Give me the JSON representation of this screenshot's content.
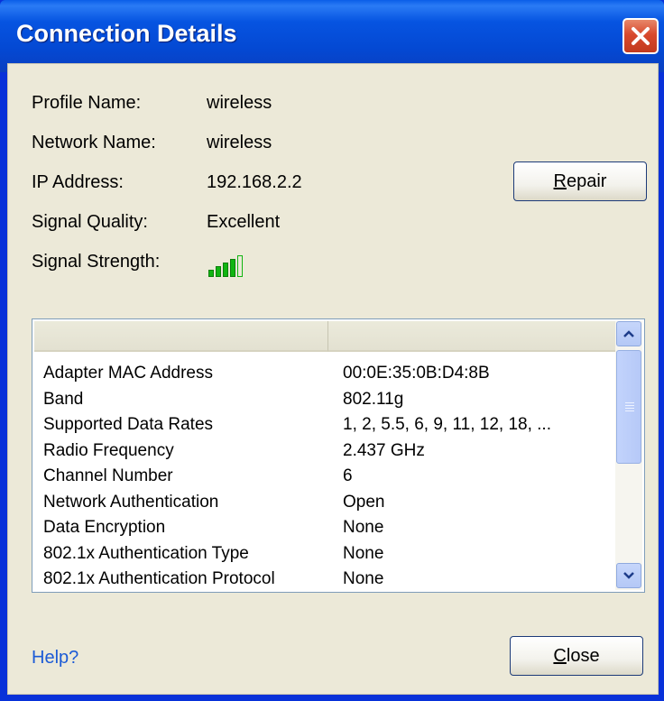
{
  "window": {
    "title": "Connection Details"
  },
  "info": {
    "profile_label": "Profile Name:",
    "profile_value": "wireless",
    "network_label": "Network Name:",
    "network_value": "wireless",
    "ip_label": "IP Address:",
    "ip_value": "192.168.2.2",
    "quality_label": "Signal Quality:",
    "quality_value": "Excellent",
    "strength_label": "Signal Strength:",
    "strength_bars_filled": 4,
    "strength_bars_total": 5
  },
  "buttons": {
    "repair_prefix": "R",
    "repair_rest": "epair",
    "close_prefix": "C",
    "close_rest": "lose"
  },
  "details": {
    "rows": [
      {
        "name": "Adapter MAC Address",
        "value": "00:0E:35:0B:D4:8B"
      },
      {
        "name": "Band",
        "value": "802.11g"
      },
      {
        "name": "Supported Data Rates",
        "value": "1, 2, 5.5, 6, 9, 11, 12, 18, ..."
      },
      {
        "name": "Radio Frequency",
        "value": "2.437 GHz"
      },
      {
        "name": "Channel Number",
        "value": "6"
      },
      {
        "name": "Network Authentication",
        "value": "Open"
      },
      {
        "name": "Data Encryption",
        "value": "None"
      },
      {
        "name": "802.1x Authentication Type",
        "value": "None"
      },
      {
        "name": "802.1x Authentication Protocol",
        "value": "None"
      }
    ]
  },
  "footer": {
    "help_link": "Help?"
  },
  "colors": {
    "signal_green": "#11b511",
    "link_blue": "#1c5bd6",
    "titlebar_blue": "#0654e1"
  }
}
